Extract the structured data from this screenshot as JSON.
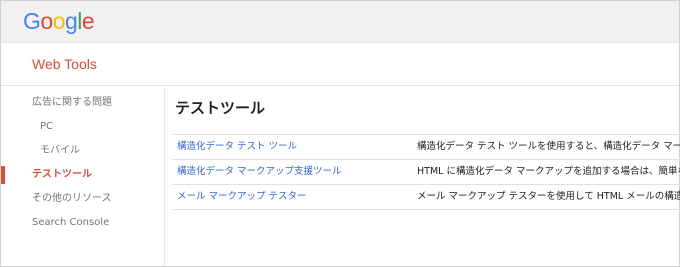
{
  "header": {
    "logo_letters": [
      {
        "char": "G",
        "color": "#4285f4"
      },
      {
        "char": "o",
        "color": "#ea4335"
      },
      {
        "char": "o",
        "color": "#fbbc05"
      },
      {
        "char": "g",
        "color": "#4285f4"
      },
      {
        "char": "l",
        "color": "#34a853"
      },
      {
        "char": "e",
        "color": "#ea4335"
      }
    ],
    "product_title": "Web Tools"
  },
  "sidebar": {
    "items": [
      {
        "label": "広告に関する問題",
        "level": 0,
        "active": false
      },
      {
        "label": "PC",
        "level": 1,
        "active": false
      },
      {
        "label": "モバイル",
        "level": 1,
        "active": false
      },
      {
        "label": "テストツール",
        "level": 0,
        "active": true
      },
      {
        "label": "その他のリソース",
        "level": 0,
        "active": false
      },
      {
        "label": "Search Console",
        "level": 0,
        "active": false
      }
    ]
  },
  "main": {
    "title": "テストツール",
    "tools": [
      {
        "name": "構造化データ テスト ツール",
        "description": "構造化データ テスト ツールを使用すると、構造化データ マーク"
      },
      {
        "name": "構造化データ マークアップ支援ツール",
        "description": "HTML に構造化データ マークアップを追加する場合は、簡単な"
      },
      {
        "name": "メール マークアップ テスター",
        "description": "メール マークアップ テスターを使用して HTML メールの構造化"
      }
    ]
  },
  "colors": {
    "accent": "#dd4b39",
    "link": "#3367d6",
    "topbar_bg": "#f1f1f1"
  }
}
